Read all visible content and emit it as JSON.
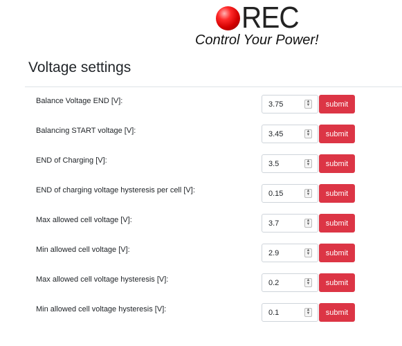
{
  "brand": {
    "name": "REC",
    "tagline": "Control Your Power!"
  },
  "section": {
    "title": "Voltage settings"
  },
  "settings": [
    {
      "label": "Balance Voltage END [V]:",
      "value": "3.75",
      "button": "submit"
    },
    {
      "label": "Balancing START voltage [V]:",
      "value": "3.45",
      "button": "submit"
    },
    {
      "label": "END of Charging [V]:",
      "value": "3.5",
      "button": "submit"
    },
    {
      "label": "END of charging voltage hysteresis per cell [V]:",
      "value": "0.15",
      "button": "submit"
    },
    {
      "label": "Max allowed cell voltage [V]:",
      "value": "3.7",
      "button": "submit"
    },
    {
      "label": "Min allowed cell voltage [V]:",
      "value": "2.9",
      "button": "submit"
    },
    {
      "label": "Max allowed cell voltage hysteresis [V]:",
      "value": "0.2",
      "button": "submit"
    },
    {
      "label": "Min allowed cell voltage hysteresis [V]:",
      "value": "0.1",
      "button": "submit"
    }
  ],
  "colors": {
    "button": "#dc3545",
    "logo_ball": "#e00000"
  },
  "icons": {
    "spinner": "number-spinner-icon",
    "logo": "red-sphere-logo-icon"
  }
}
